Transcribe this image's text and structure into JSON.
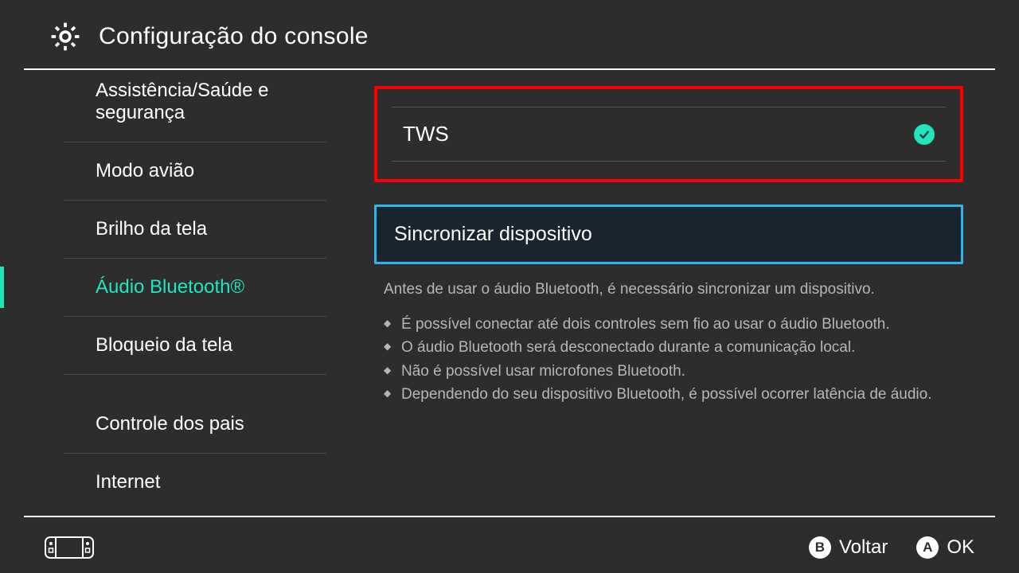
{
  "header": {
    "title": "Configuração do console"
  },
  "sidebar": {
    "items": [
      {
        "label": "Assistência/Saúde e segurança",
        "active": false
      },
      {
        "label": "Modo avião",
        "active": false
      },
      {
        "label": "Brilho da tela",
        "active": false
      },
      {
        "label": "Áudio Bluetooth®",
        "active": true
      },
      {
        "label": "Bloqueio da tela",
        "active": false
      },
      {
        "label": "Controle dos pais",
        "active": false
      },
      {
        "label": "Internet",
        "active": false
      }
    ]
  },
  "content": {
    "device_name": "TWS",
    "device_connected": true,
    "pair_label": "Sincronizar dispositivo",
    "helper_lead": "Antes de usar o áudio Bluetooth, é necessário sincronizar um dispositivo.",
    "helper_bullets": [
      "É possível conectar até dois controles sem fio ao usar o áudio Bluetooth.",
      "O áudio Bluetooth será desconectado durante a comunicação local.",
      "Não é possível usar microfones Bluetooth.",
      "Dependendo do seu dispositivo Bluetooth, é possível ocorrer latência de áudio."
    ]
  },
  "footer": {
    "back_key": "B",
    "back_label": "Voltar",
    "ok_key": "A",
    "ok_label": "OK"
  },
  "colors": {
    "accent": "#20e6c0",
    "highlight_border": "#2bb8e6",
    "alert_border": "#ff0000",
    "background": "#2d2d2d"
  }
}
